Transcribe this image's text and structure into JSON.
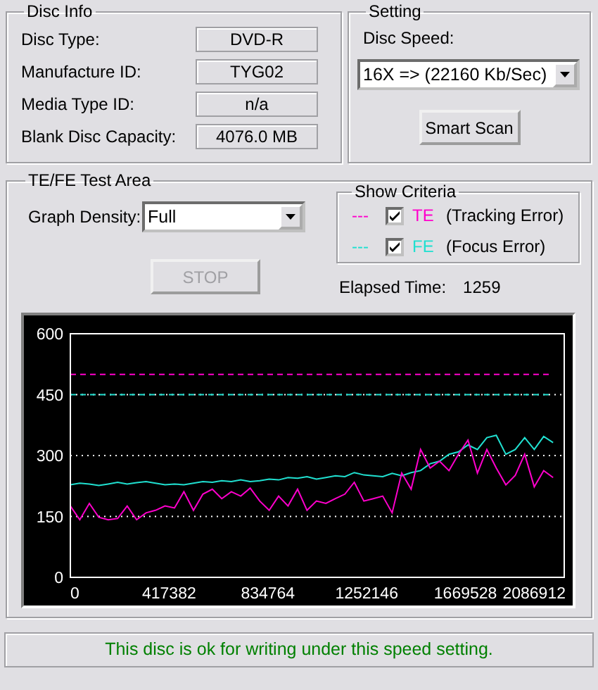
{
  "disc_info": {
    "title": "Disc Info",
    "fields": [
      {
        "label": "Disc Type:",
        "value": "DVD-R"
      },
      {
        "label": "Manufacture ID:",
        "value": "TYG02"
      },
      {
        "label": "Media Type ID:",
        "value": "n/a"
      },
      {
        "label": "Blank Disc Capacity:",
        "value": "4076.0 MB"
      }
    ]
  },
  "setting": {
    "title": "Setting",
    "speed_label": "Disc Speed:",
    "speed_value": "16X => (22160 Kb/Sec)",
    "button": "Smart Scan"
  },
  "test_area": {
    "title": "TE/FE Test Area",
    "density_label": "Graph Density:",
    "density_value": "Full",
    "stop_button": {
      "label": "STOP",
      "disabled": true
    },
    "criteria": {
      "title": "Show Criteria",
      "items": [
        {
          "dash": "---",
          "checked": true,
          "code": "TE",
          "description": "(Tracking Error)",
          "color": "#ff00cc"
        },
        {
          "dash": "---",
          "checked": true,
          "code": "FE",
          "description": "(Focus Error)",
          "color": "#20e0d0"
        }
      ]
    },
    "elapsed_label": "Elapsed Time:",
    "elapsed_value": "1259",
    "chart_data": {
      "type": "line",
      "xlim": [
        0,
        2086912
      ],
      "ylim": [
        0,
        600
      ],
      "xticks": [
        0,
        417382,
        834764,
        1252146,
        1669528,
        2086912
      ],
      "yticks": [
        0,
        150,
        300,
        450,
        600
      ],
      "x": [
        0,
        40000,
        80000,
        120000,
        160000,
        200000,
        240000,
        280000,
        320000,
        360000,
        400000,
        440000,
        480000,
        520000,
        560000,
        600000,
        640000,
        680000,
        720000,
        760000,
        800000,
        840000,
        880000,
        920000,
        960000,
        1000000,
        1040000,
        1080000,
        1120000,
        1160000,
        1200000,
        1240000,
        1280000,
        1320000,
        1360000,
        1400000,
        1440000,
        1480000,
        1520000,
        1560000,
        1600000,
        1640000,
        1680000,
        1720000,
        1760000,
        1800000,
        1840000,
        1880000,
        1920000,
        1960000,
        2000000,
        2040000
      ],
      "series": [
        {
          "color": "#20e0d0",
          "values": [
            228,
            232,
            230,
            226,
            230,
            234,
            230,
            233,
            236,
            232,
            228,
            230,
            228,
            232,
            236,
            234,
            238,
            236,
            240,
            236,
            238,
            242,
            240,
            246,
            244,
            248,
            242,
            246,
            250,
            248,
            258,
            252,
            250,
            248,
            256,
            250,
            258,
            263,
            280,
            286,
            303,
            309,
            326,
            315,
            344,
            350,
            303,
            315,
            344,
            315,
            347,
            332
          ]
        },
        {
          "color": "#ff00cc",
          "values": [
            176,
            142,
            182,
            148,
            142,
            145,
            176,
            142,
            159,
            165,
            176,
            171,
            211,
            165,
            205,
            217,
            194,
            211,
            200,
            220,
            188,
            165,
            200,
            176,
            217,
            165,
            188,
            182,
            194,
            205,
            234,
            188,
            194,
            200,
            159,
            257,
            217,
            315,
            269,
            286,
            263,
            303,
            338,
            257,
            315,
            269,
            228,
            251,
            303,
            223,
            263,
            246
          ]
        }
      ],
      "grid": true,
      "ref_lines": [
        {
          "axis": "y",
          "value": 500,
          "color": "#ff00cc"
        },
        {
          "axis": "y",
          "value": 450,
          "color": "#20e0d0"
        }
      ]
    }
  },
  "status": "This disc is ok for writing under this speed setting."
}
